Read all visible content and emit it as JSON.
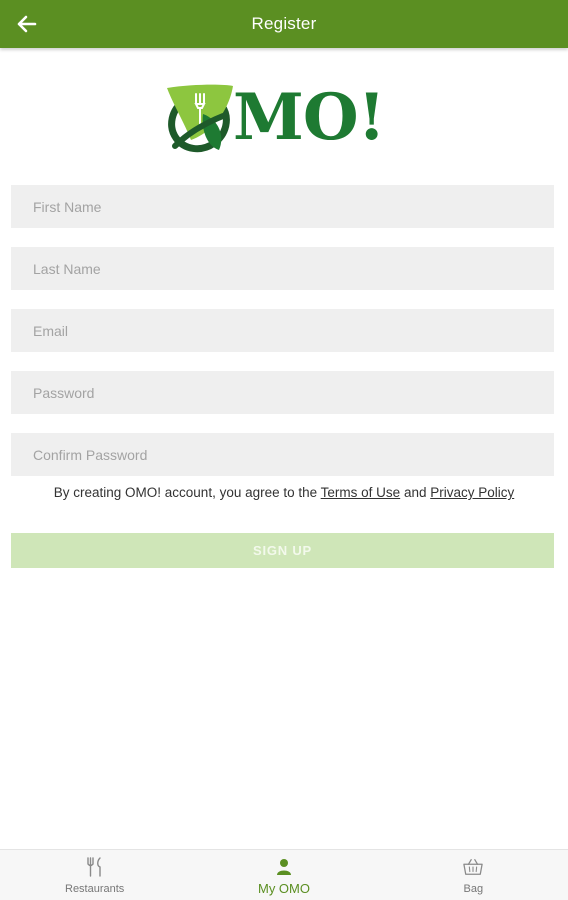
{
  "appbar": {
    "title": "Register",
    "back_icon": "arrow-left-icon",
    "background": "#5b8f22"
  },
  "logo": {
    "text": "MO!",
    "icon": "leaf-fork-logo-icon",
    "color": "#1e7a32",
    "leaf_color": "#8dc63f"
  },
  "form": {
    "first_name": {
      "placeholder": "First Name",
      "value": ""
    },
    "last_name": {
      "placeholder": "Last Name",
      "value": ""
    },
    "email": {
      "placeholder": "Email",
      "value": ""
    },
    "password": {
      "placeholder": "Password",
      "value": ""
    },
    "confirm_password": {
      "placeholder": "Confirm Password",
      "value": ""
    },
    "terms_prefix": "By creating OMO! account, you agree to the ",
    "terms_link": "Terms of Use",
    "terms_and": " and ",
    "privacy_link": "Privacy Policy",
    "signup_label": "SIGN UP",
    "signup_color": "#cfe6b8"
  },
  "bottom_nav": {
    "items": [
      {
        "label": "Restaurants",
        "icon": "fork-knife-icon",
        "active": false
      },
      {
        "label": "My OMO",
        "icon": "person-icon",
        "active": true
      },
      {
        "label": "Bag",
        "icon": "basket-icon",
        "active": false
      }
    ],
    "active_color": "#5b8f22"
  }
}
